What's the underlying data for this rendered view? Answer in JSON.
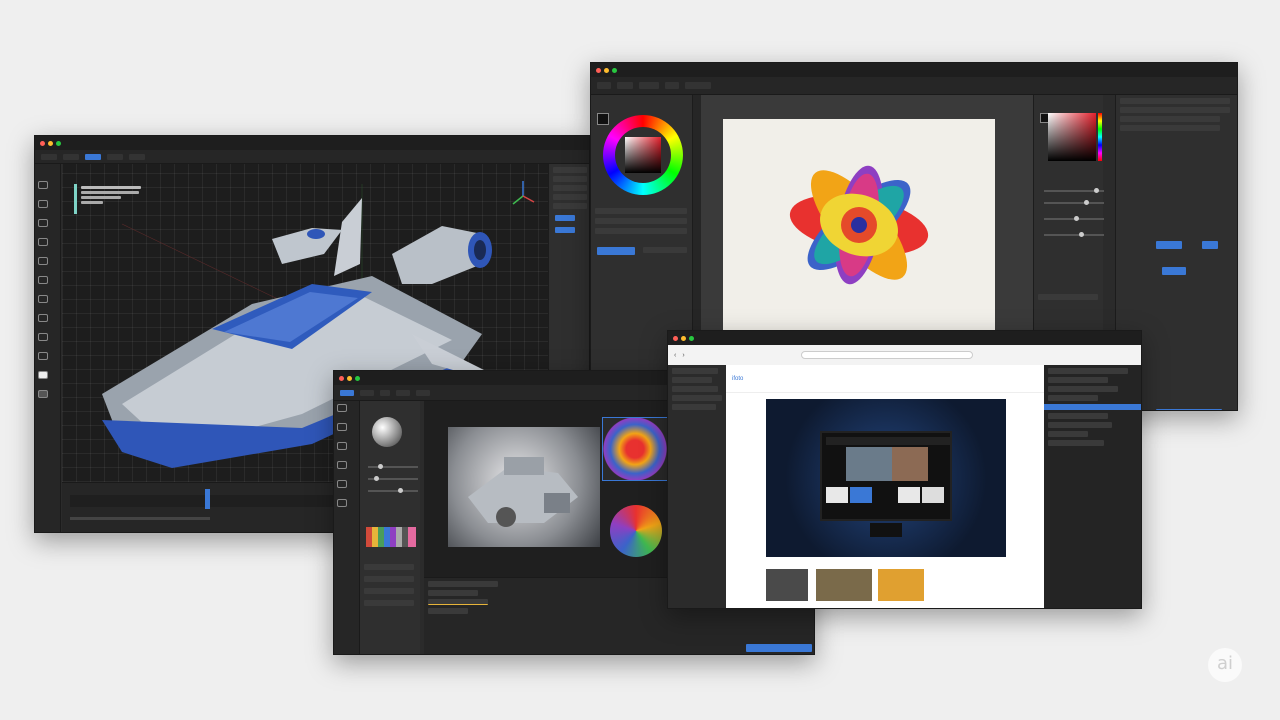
{
  "watermark": {
    "text": "ai"
  },
  "colors": {
    "accent": "#3a78d6",
    "window_bg": "#2b2b2b",
    "page_bg": "#efefef"
  },
  "modeling_window": {
    "menu": [
      "",
      "",
      "",
      ""
    ],
    "outliner_lines": [
      "",
      "",
      "",
      ""
    ]
  },
  "paint_window": {
    "menu": [
      "",
      "",
      "",
      ""
    ]
  },
  "texture_window": {
    "menu": [
      "",
      "",
      "",
      ""
    ]
  },
  "browser_window": {
    "site_logo": "ifoto",
    "page_heading": "",
    "address": ""
  },
  "icons": [
    "close-dot",
    "minimize-dot",
    "maximize-dot",
    "gizmo-axes-icon",
    "color-wheel-icon",
    "sphere-preview-icon"
  ]
}
